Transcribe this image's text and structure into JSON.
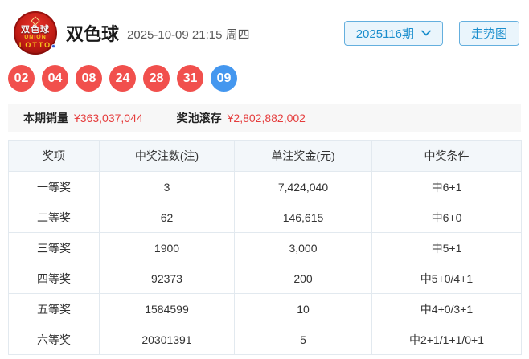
{
  "header": {
    "logo": {
      "cn": "双色球",
      "en1": "UNION",
      "en2": "LOTTO"
    },
    "title": "双色球",
    "datetime": "2025-10-09 21:15 周四",
    "issue_select_label": "2025116期",
    "trend_button_label": "走势图"
  },
  "draw": {
    "red_balls": [
      "02",
      "04",
      "08",
      "24",
      "28",
      "31"
    ],
    "blue_ball": "09"
  },
  "stats": {
    "sales_label": "本期销量",
    "sales_value": "¥363,037,044",
    "pool_label": "奖池滚存",
    "pool_value": "¥2,802,882,002"
  },
  "prize_table": {
    "headers": [
      "奖项",
      "中奖注数(注)",
      "单注奖金(元)",
      "中奖条件"
    ],
    "rows": [
      [
        "一等奖",
        "3",
        "7,424,040",
        "中6+1"
      ],
      [
        "二等奖",
        "62",
        "146,615",
        "中6+0"
      ],
      [
        "三等奖",
        "1900",
        "3,000",
        "中5+1"
      ],
      [
        "四等奖",
        "92373",
        "200",
        "中5+0/4+1"
      ],
      [
        "五等奖",
        "1584599",
        "10",
        "中4+0/3+1"
      ],
      [
        "六等奖",
        "20301391",
        "5",
        "中2+1/1+1/0+1"
      ]
    ]
  },
  "colors": {
    "red_ball": "#f1504d",
    "blue_ball": "#4497ef",
    "accent_blue": "#1b8ecd",
    "value_red": "#e53c3c",
    "table_header_bg": "#f3f7fa",
    "table_border": "#e2e9ef",
    "stats_bg": "#f7f7f7"
  }
}
